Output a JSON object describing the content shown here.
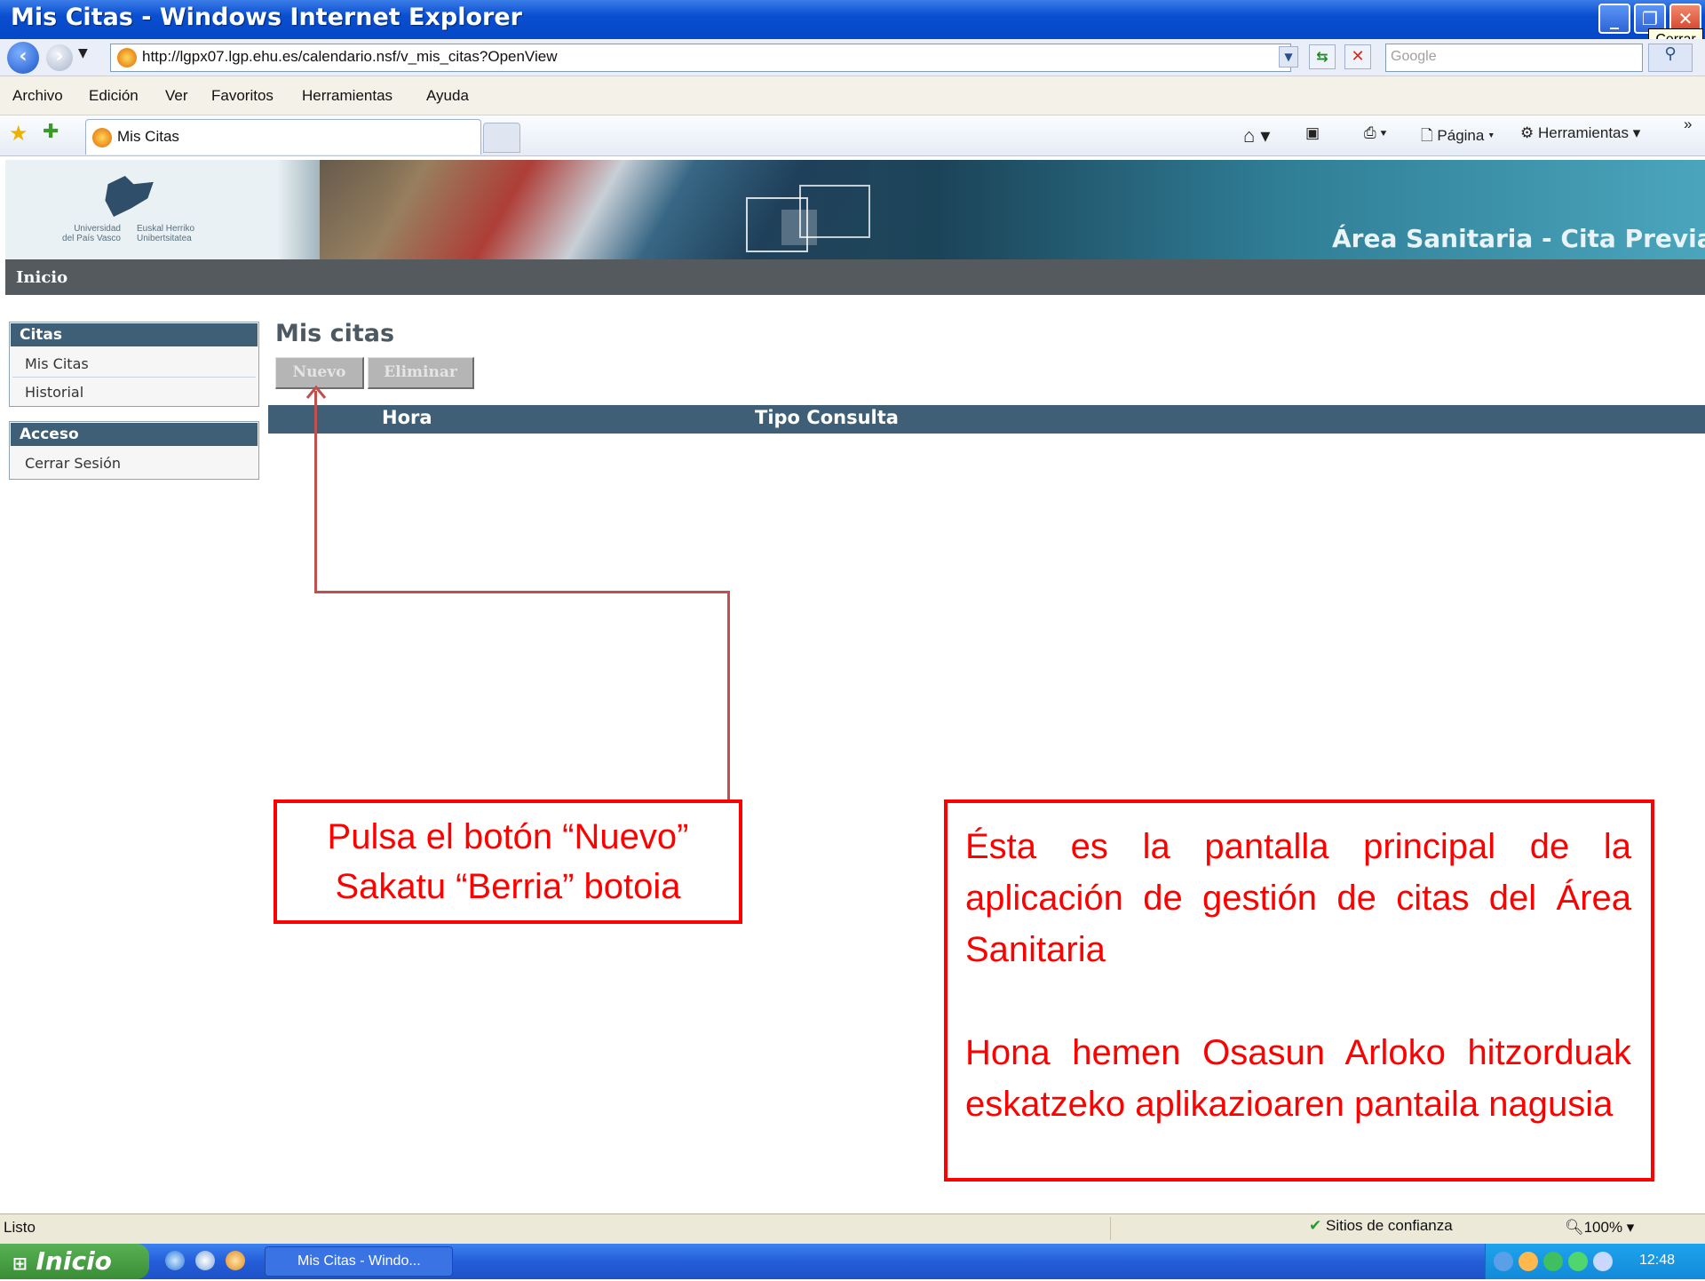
{
  "window": {
    "title": "Mis Citas - Windows Internet Explorer",
    "tooltip": "Cerrar"
  },
  "address": {
    "url": "http://lgpx07.lgp.ehu.es/calendario.nsf/v_mis_citas?OpenView",
    "search_placeholder": "Google"
  },
  "menu": [
    "Archivo",
    "Edición",
    "Ver",
    "Favoritos",
    "Herramientas",
    "Ayuda"
  ],
  "tab": {
    "label": "Mis Citas"
  },
  "commands": {
    "pagina": "Página",
    "herramientas": "Herramientas"
  },
  "banner": {
    "logo_es": "Universidad\ndel País Vasco",
    "logo_eu": "Euskal Herriko\nUnibertsitatea",
    "title": "Área Sanitaria - Cita Previa"
  },
  "nav": {
    "home": "Inicio"
  },
  "sidebar": {
    "sections": [
      {
        "title": "Citas",
        "items": [
          "Mis Citas",
          "Historial"
        ]
      },
      {
        "title": "Acceso",
        "items": [
          "Cerrar Sesión"
        ]
      }
    ]
  },
  "main": {
    "title": "Mis citas",
    "buttons": {
      "new": "Nuevo",
      "delete": "Eliminar"
    },
    "columns": [
      "Hora",
      "Tipo Consulta"
    ]
  },
  "annotations": {
    "left": [
      "Pulsa el botón “Nuevo”",
      "Sakatu “Berria” botoia"
    ],
    "right_es": "Ésta es la pantalla principal de la aplicación de gestión de citas del Área Sanitaria",
    "right_eu": "Hona hemen Osasun Arloko hitzorduak eskatzeko aplikazioaren pantaila nagusia"
  },
  "status": {
    "text": "Listo",
    "zone": "Sitios de confianza",
    "zoom": "100%"
  },
  "taskbar": {
    "start": "Inicio",
    "task": "Mis Citas - Windo...",
    "clock": "12:48"
  },
  "colors": {
    "accent": "#3f5f76",
    "annotation": "#ff0000",
    "navbar": "#555a5e"
  }
}
